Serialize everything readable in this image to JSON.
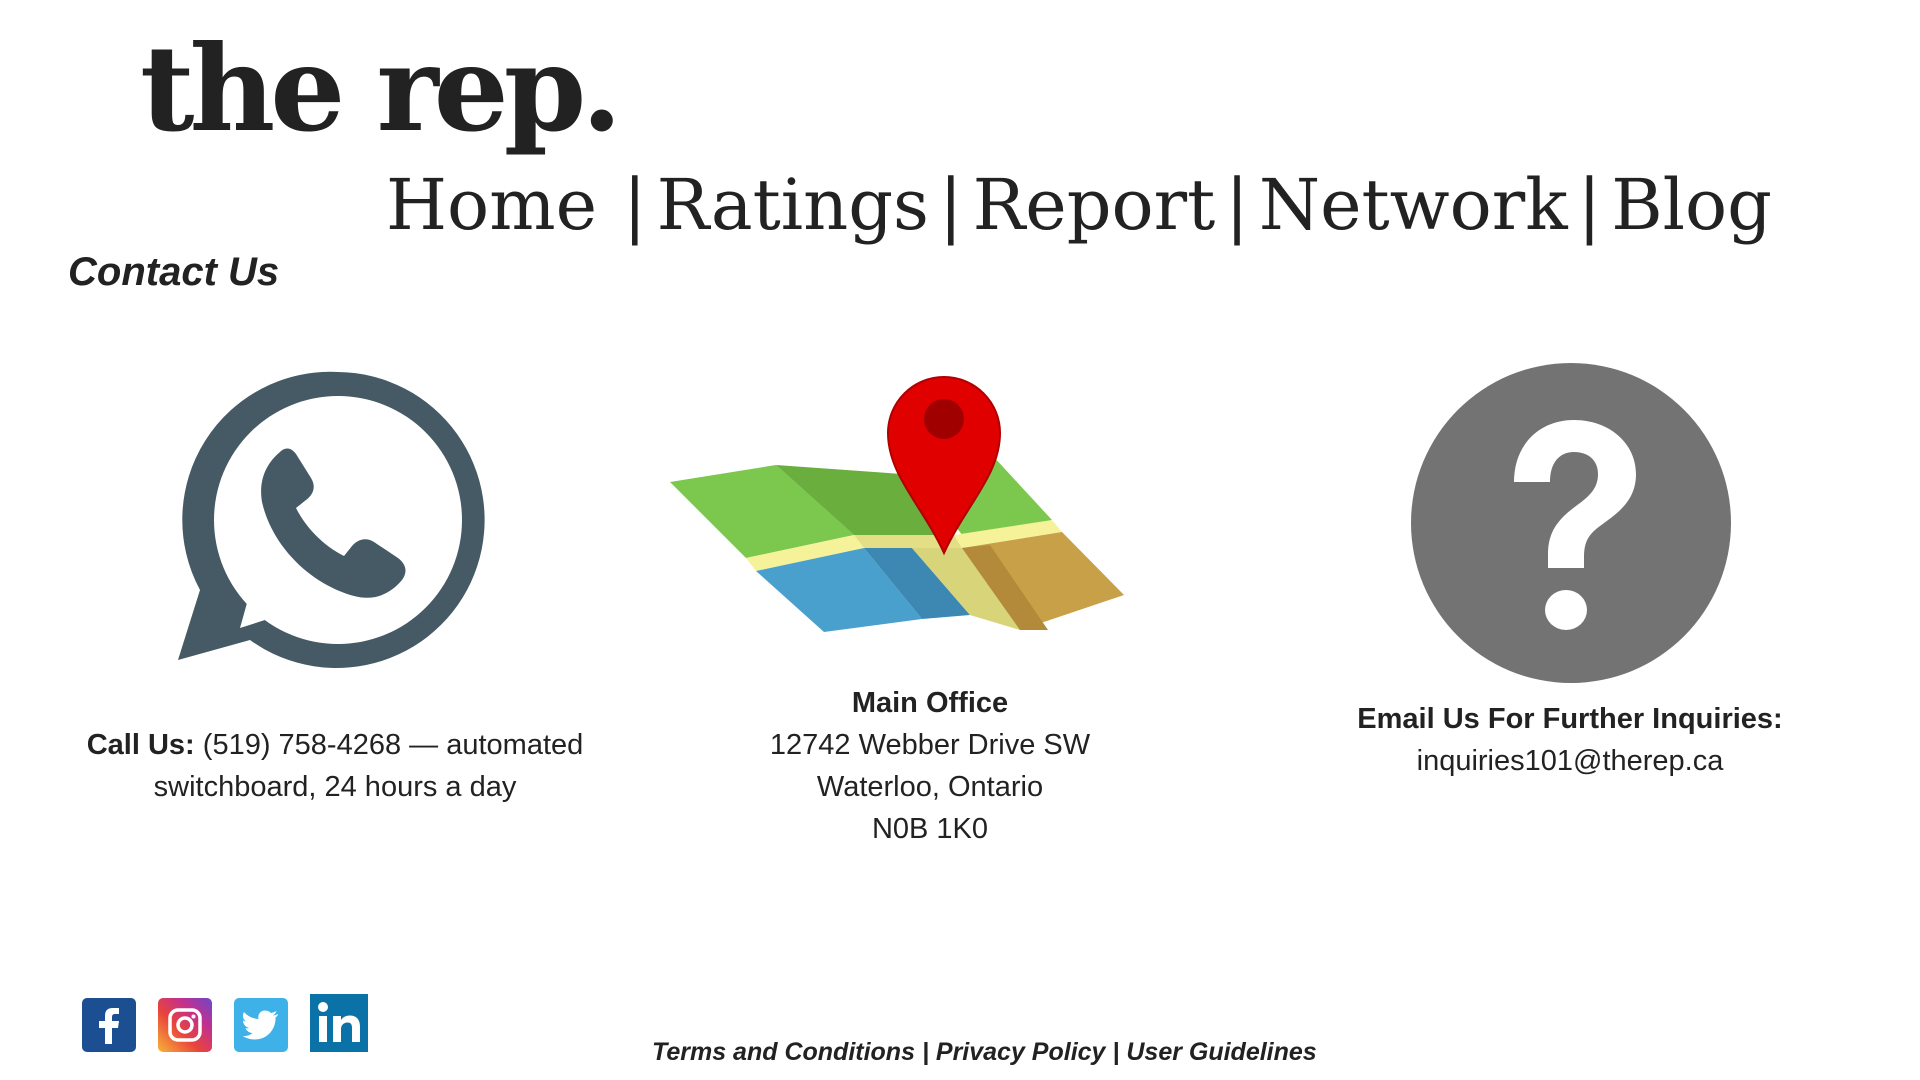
{
  "header": {
    "logo": "the rep.",
    "nav": [
      {
        "label": "Home"
      },
      {
        "label": "Ratings"
      },
      {
        "label": "Report"
      },
      {
        "label": "Network"
      },
      {
        "label": "Blog"
      }
    ],
    "separator": "|"
  },
  "page_title": "Contact Us",
  "contact": {
    "phone": {
      "label": "Call Us:",
      "number": "(519) 758-4268",
      "note": " — automated switchboard, 24 hours a day",
      "icon": "whatsapp-phone-icon"
    },
    "office": {
      "heading": "Main Office",
      "street": "12742 Webber Drive SW",
      "city": "Waterloo, Ontario",
      "postal": "N0B 1K0",
      "icon": "map-pin-icon"
    },
    "email": {
      "heading": "Email Us For Further Inquiries:",
      "address": "inquiries101@therep.ca",
      "icon": "question-mark-icon"
    }
  },
  "social": [
    {
      "name": "facebook-icon",
      "color": "#1c4f91"
    },
    {
      "name": "instagram-icon",
      "color": "#c2308f"
    },
    {
      "name": "twitter-icon",
      "color": "#3eb1e8"
    },
    {
      "name": "linkedin-icon",
      "color": "#0b72a8"
    }
  ],
  "footer": {
    "links": [
      "Terms and Conditions",
      "Privacy Policy",
      "User Guidelines"
    ],
    "separator": "|"
  },
  "colors": {
    "text": "#222222",
    "phone_icon": "#455a64",
    "help_icon": "#737373",
    "pin": "#e00000"
  }
}
